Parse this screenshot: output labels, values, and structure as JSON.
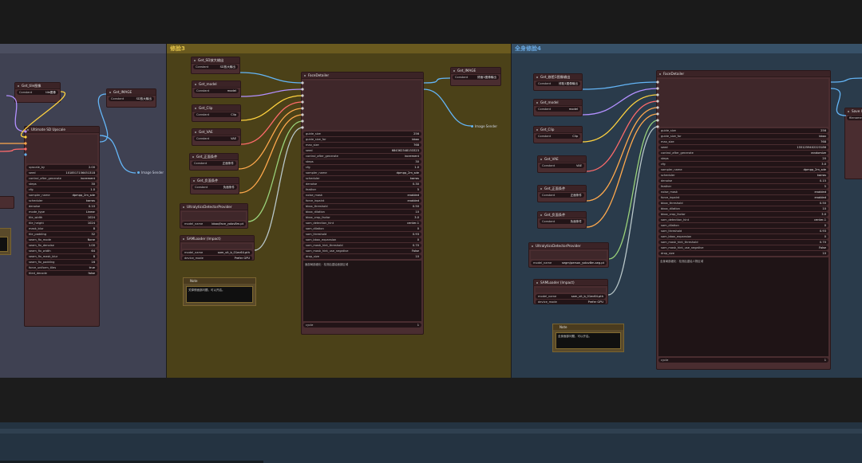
{
  "groups": {
    "left_title": "",
    "mid_title": "修脸3",
    "right_title": "全身修脸4"
  },
  "colors": {
    "link_vae": "#ff6b6b",
    "link_model": "#b390ff",
    "link_clip": "#ffd23f",
    "link_cond": "#ffa94d",
    "link_image": "#64b5f6",
    "link_bbox": "#9ad27a"
  },
  "left": {
    "get_small": "Get_tile图像",
    "get_small_const": "tile图像",
    "get_image": "Get_IMAGE",
    "get_image_const": "SD放大输出",
    "constant_label": "Constant",
    "upscale_title": "Ultimate SD Upscale",
    "upscale_rows": [
      [
        "upscale_by",
        "2.00"
      ],
      [
        "seed",
        "1018517156451318"
      ],
      [
        "control_after_generate",
        "increment"
      ],
      [
        "steps",
        "30"
      ],
      [
        "cfg",
        "1.0"
      ],
      [
        "sampler_name",
        "dpmpp_2m_sde"
      ],
      [
        "scheduler",
        "karras"
      ],
      [
        "denoise",
        "0.10"
      ],
      [
        "mode_type",
        "Linear"
      ],
      [
        "tile_width",
        "1024"
      ],
      [
        "tile_height",
        "1024"
      ],
      [
        "mask_blur",
        "8"
      ],
      [
        "tile_padding",
        "32"
      ],
      [
        "seam_fix_mode",
        "None"
      ],
      [
        "seam_fix_denoise",
        "1.00"
      ],
      [
        "seam_fix_width",
        "64"
      ],
      [
        "seam_fix_mask_blur",
        "8"
      ],
      [
        "seam_fix_padding",
        "16"
      ],
      [
        "force_uniform_tiles",
        "true"
      ],
      [
        "tiled_decode",
        "false"
      ]
    ],
    "save_label": "Image Sender"
  },
  "mid": {
    "constant_label": "Constant",
    "gets": [
      {
        "title": "Get_SD放大输出",
        "const": "SD放大输出"
      },
      {
        "title": "Get_model",
        "const": "model"
      },
      {
        "title": "Get_Clip",
        "const": "Clip"
      },
      {
        "title": "Get_VAE",
        "const": "VAE"
      },
      {
        "title": "Get_正面条件",
        "const": "正面条件"
      },
      {
        "title": "Get_负面条件",
        "const": "负面条件"
      }
    ],
    "detector_title": "UltralyticsDetectorProvider",
    "detector_row": [
      "model_name",
      "bbox/face_yolov8m.pt"
    ],
    "sam_title": "SAMLoader (Impact)",
    "sam_rows": [
      [
        "model_name",
        "sam_vit_b_01ec64.pth"
      ],
      [
        "device_mode",
        "Prefer GPU"
      ]
    ],
    "note_title": "Note",
    "note_text": "关掉修面部问题，可以开启。",
    "face_title": "FaceDetailer",
    "face_rows": [
      [
        "guide_size",
        "256"
      ],
      [
        "guide_size_for",
        "bbox"
      ],
      [
        "max_size",
        "768"
      ],
      [
        "seed",
        "684362348153323"
      ],
      [
        "control_after_generate",
        "increment"
      ],
      [
        "steps",
        "30"
      ],
      [
        "cfg",
        "1.0"
      ],
      [
        "sampler_name",
        "dpmpp_2m_sde"
      ],
      [
        "scheduler",
        "karras"
      ],
      [
        "denoise",
        "0.30"
      ],
      [
        "feather",
        "5"
      ],
      [
        "noise_mask",
        "enabled"
      ],
      [
        "force_inpaint",
        "enabled"
      ],
      [
        "bbox_threshold",
        "0.50"
      ],
      [
        "bbox_dilation",
        "10"
      ],
      [
        "bbox_crop_factor",
        "3.0"
      ],
      [
        "sam_detection_hint",
        "center-1"
      ],
      [
        "sam_dilation",
        "0"
      ],
      [
        "sam_threshold",
        "0.93"
      ],
      [
        "sam_bbox_expansion",
        "0"
      ],
      [
        "sam_mask_hint_threshold",
        "0.70"
      ],
      [
        "sam_mask_hint_use_negative",
        "False"
      ],
      [
        "drop_size",
        "10"
      ]
    ],
    "face_text": "面部局部细化 · 检测后重绘面部区域",
    "face_cycle": [
      "cycle",
      "1"
    ],
    "out_get": "Get_IMAGE",
    "out_const": "修面1图像输出",
    "save_label": "Image Sender"
  },
  "right": {
    "constant_label": "Constant",
    "gets": [
      {
        "title": "Get_修脸1图像输出",
        "const": "修脸1图像输出"
      },
      {
        "title": "Get_model",
        "const": "model"
      },
      {
        "title": "Get_Clip",
        "const": "Clip"
      },
      {
        "title": "Get_VAE",
        "const": "VAE"
      },
      {
        "title": "Get_正面条件",
        "const": "正面条件"
      },
      {
        "title": "Get_负面条件",
        "const": "负面条件"
      }
    ],
    "detector_title": "UltralyticsDetectorProvider",
    "detector_row": [
      "model_name",
      "segm/person_yolov8m-seg.pt"
    ],
    "sam_title": "SAMLoader (Impact)",
    "sam_rows": [
      [
        "model_name",
        "sam_vit_b_01ec64.pth"
      ],
      [
        "device_mode",
        "Prefer GPU"
      ]
    ],
    "note_title": "Note",
    "note_text": "全身面部问题，可以开启。",
    "face_title": "FaceDetailer",
    "face_rows": [
      [
        "guide_size",
        "256"
      ],
      [
        "guide_size_for",
        "bbox"
      ],
      [
        "max_size",
        "768"
      ],
      [
        "seed",
        "1551259402223186"
      ],
      [
        "control_after_generate",
        "randomize"
      ],
      [
        "steps",
        "20"
      ],
      [
        "cfg",
        "3.0"
      ],
      [
        "sampler_name",
        "dpmpp_2m_sde"
      ],
      [
        "scheduler",
        "karras"
      ],
      [
        "denoise",
        "0.15"
      ],
      [
        "feather",
        "5"
      ],
      [
        "noise_mask",
        "enabled"
      ],
      [
        "force_inpaint",
        "enabled"
      ],
      [
        "bbox_threshold",
        "0.50"
      ],
      [
        "bbox_dilation",
        "10"
      ],
      [
        "bbox_crop_factor",
        "3.0"
      ],
      [
        "sam_detection_hint",
        "center-1"
      ],
      [
        "sam_dilation",
        "0"
      ],
      [
        "sam_threshold",
        "0.93"
      ],
      [
        "sam_bbox_expansion",
        "0"
      ],
      [
        "sam_mask_hint_threshold",
        "0.70"
      ],
      [
        "sam_mask_hint_use_negative",
        "False"
      ],
      [
        "drop_size",
        "10"
      ]
    ],
    "face_text": "全身局部细化 · 检测后重绘人物区域",
    "face_cycle": [
      "cycle",
      "1"
    ],
    "side_title": "Save Image",
    "side_row": "filename"
  }
}
